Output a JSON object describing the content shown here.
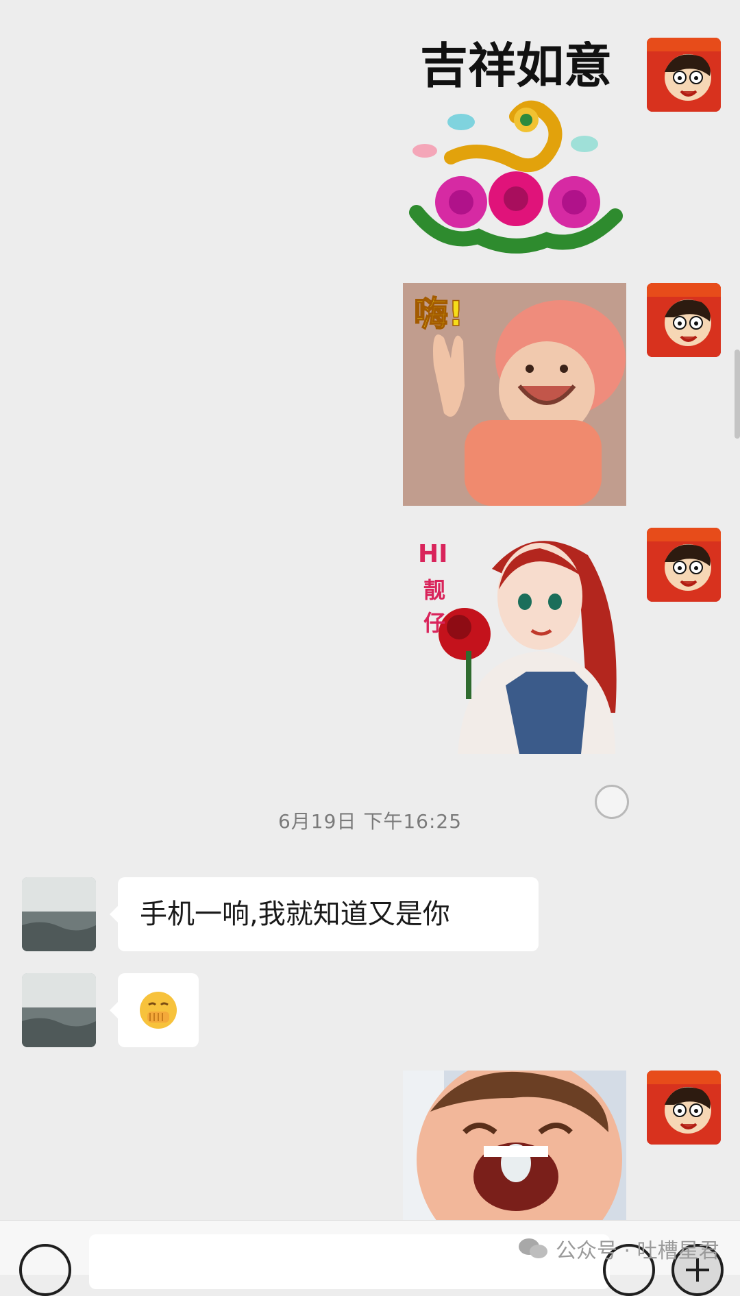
{
  "timestamp": "6月19日 下午16:25",
  "messages": [
    {
      "sender": "self",
      "type": "sticker",
      "text": "吉祥如意"
    },
    {
      "sender": "self",
      "type": "sticker",
      "text": "嗨!"
    },
    {
      "sender": "self",
      "type": "sticker",
      "text_lines": [
        "HI",
        "靓",
        "仔"
      ]
    },
    {
      "sender": "other",
      "type": "text",
      "text": "手机一响,我就知道又是你"
    },
    {
      "sender": "other",
      "type": "emoji",
      "icon": "hand-over-mouth-emoji"
    },
    {
      "sender": "self",
      "type": "sticker",
      "icon": "laughing-kid-photo"
    }
  ],
  "watermark": {
    "text": "公众号 · 吐槽星君"
  },
  "colors": {
    "background": "#ededed",
    "bubble": "#ffffff",
    "avatar_self": "#d8321e"
  }
}
